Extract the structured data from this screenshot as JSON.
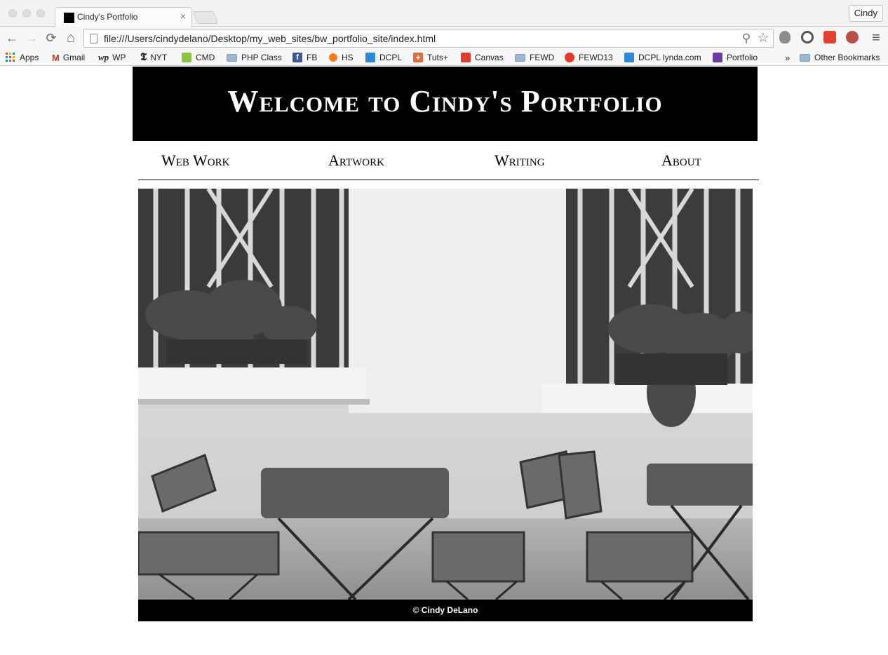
{
  "browser": {
    "tab_title": "Cindy's Portfolio",
    "tab_close_icon": "×",
    "profile_name": "Cindy",
    "url": "file:///Users/cindydelano/Desktop/my_web_sites/bw_portfolio_site/index.html",
    "nav_icons": {
      "back": "←",
      "forward": "→",
      "reload": "⟳",
      "home": "⌂"
    },
    "omnibox_icons": {
      "search": "⚲",
      "star": "☆"
    },
    "menu_icon": "≡",
    "bookmarks": [
      {
        "label": "Apps",
        "icon": "apps-grid-icon",
        "color": "#e44d3a"
      },
      {
        "label": "Gmail",
        "icon": "gmail-icon",
        "color": "#d93025"
      },
      {
        "label": "WP",
        "icon": "washington-post-icon",
        "color": "#111111"
      },
      {
        "label": "NYT",
        "icon": "nyt-icon",
        "color": "#111111"
      },
      {
        "label": "CMD",
        "icon": "cmd-icon",
        "color": "#8cc63f"
      },
      {
        "label": "PHP Class",
        "icon": "folder-icon",
        "color": "#9bb7d1"
      },
      {
        "label": "FB",
        "icon": "facebook-icon",
        "color": "#3b5998"
      },
      {
        "label": "HS",
        "icon": "hs-icon",
        "color": "#f57c1f"
      },
      {
        "label": "DCPL",
        "icon": "lynda-icon",
        "color": "#2b89d8"
      },
      {
        "label": "Tuts+",
        "icon": "tuts-plus-icon",
        "color": "#e06d3b"
      },
      {
        "label": "Canvas",
        "icon": "canvas-icon",
        "color": "#e03e2d"
      },
      {
        "label": "FEWD",
        "icon": "folder-icon",
        "color": "#9bb7d1"
      },
      {
        "label": "FEWD13",
        "icon": "ga-icon",
        "color": "#e53a2f"
      },
      {
        "label": "DCPL lynda.com",
        "icon": "lynda-icon",
        "color": "#2b89d8"
      },
      {
        "label": "Portfolio",
        "icon": "portfolio-icon",
        "color": "#6a3aa5"
      }
    ],
    "more_bookmarks": "»",
    "other_bookmarks": "Other Bookmarks"
  },
  "page": {
    "title": "Welcome to Cindy's Portfolio",
    "nav": [
      "Web Work",
      "Artwork",
      "Writing",
      "About"
    ],
    "photo_subject": "cafe-tables-photo",
    "footer": "© Cindy DeLano"
  }
}
